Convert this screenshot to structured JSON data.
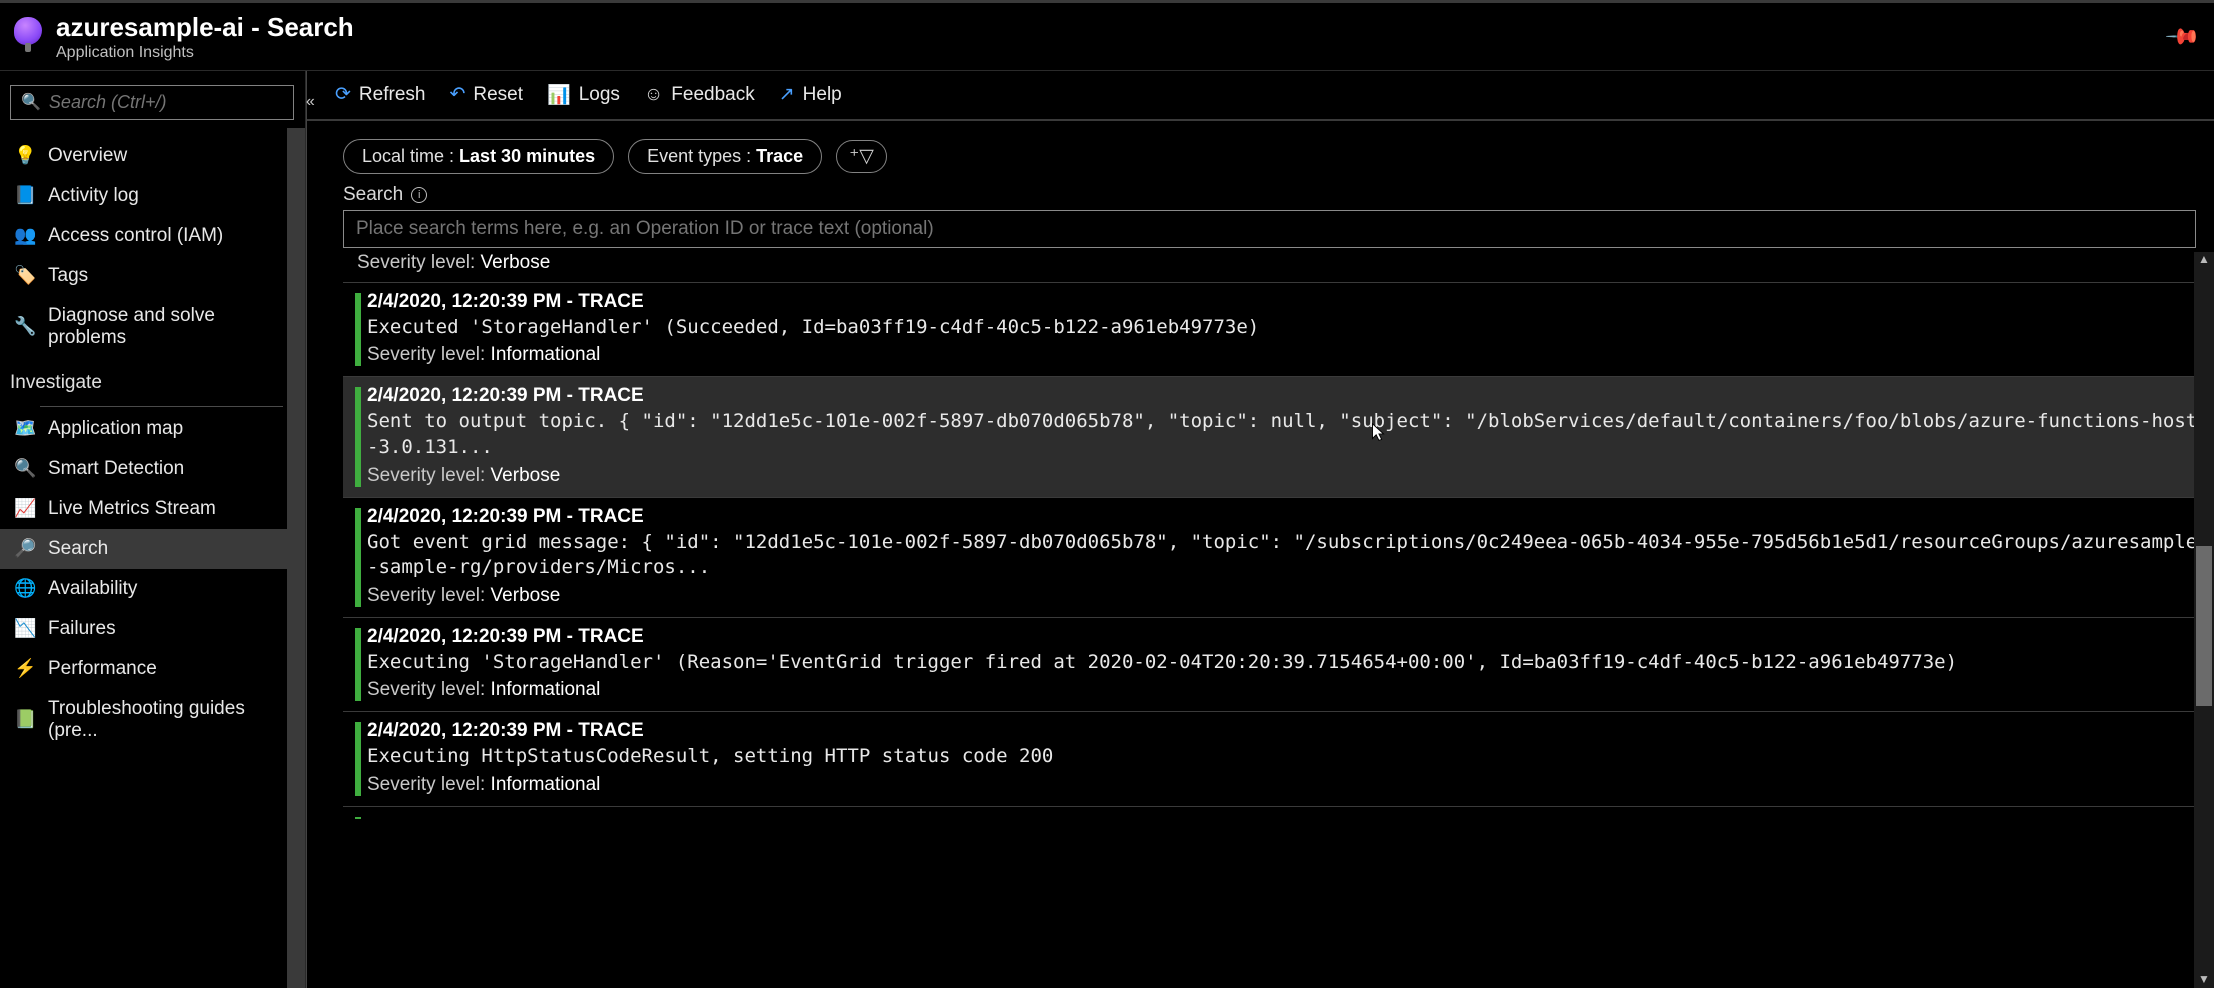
{
  "header": {
    "title": "azuresample-ai - Search",
    "subtitle": "Application Insights"
  },
  "sidebar": {
    "search_placeholder": "Search (Ctrl+/)",
    "items_top": [
      {
        "icon": "💡",
        "label": "Overview",
        "name": "sidebar-item-overview"
      },
      {
        "icon": "📘",
        "label": "Activity log",
        "name": "sidebar-item-activity-log"
      },
      {
        "icon": "👥",
        "label": "Access control (IAM)",
        "name": "sidebar-item-access-control"
      },
      {
        "icon": "🏷️",
        "label": "Tags",
        "name": "sidebar-item-tags"
      },
      {
        "icon": "🔧",
        "label": "Diagnose and solve problems",
        "name": "sidebar-item-diagnose"
      }
    ],
    "section_investigate": "Investigate",
    "items_investigate": [
      {
        "icon": "🗺️",
        "label": "Application map",
        "name": "sidebar-item-application-map"
      },
      {
        "icon": "🔍",
        "label": "Smart Detection",
        "name": "sidebar-item-smart-detection"
      },
      {
        "icon": "📈",
        "label": "Live Metrics Stream",
        "name": "sidebar-item-live-metrics"
      },
      {
        "icon": "🔎",
        "label": "Search",
        "name": "sidebar-item-search",
        "selected": true
      },
      {
        "icon": "🌐",
        "label": "Availability",
        "name": "sidebar-item-availability"
      },
      {
        "icon": "📉",
        "label": "Failures",
        "name": "sidebar-item-failures"
      },
      {
        "icon": "⚡",
        "label": "Performance",
        "name": "sidebar-item-performance"
      },
      {
        "icon": "📗",
        "label": "Troubleshooting guides (pre...",
        "name": "sidebar-item-troubleshooting"
      }
    ]
  },
  "toolbar": {
    "refresh": "Refresh",
    "reset": "Reset",
    "logs": "Logs",
    "feedback": "Feedback",
    "help": "Help"
  },
  "filters": {
    "time_prefix": "Local time : ",
    "time_value": "Last 30 minutes",
    "type_prefix": "Event types : ",
    "type_value": "Trace"
  },
  "search": {
    "label": "Search",
    "placeholder": "Place search terms here, e.g. an Operation ID or trace text (optional)"
  },
  "severity_label": "Severity level:",
  "top_sev_value": "Verbose",
  "traces": [
    {
      "head": "2/4/2020, 12:20:39 PM - TRACE",
      "msg": "Executed 'StorageHandler' (Succeeded, Id=ba03ff19-c4df-40c5-b122-a961eb49773e)",
      "sev": "Informational"
    },
    {
      "head": "2/4/2020, 12:20:39 PM - TRACE",
      "msg": "Sent to output topic. { \"id\": \"12dd1e5c-101e-002f-5897-db070d065b78\", \"topic\": null, \"subject\": \"/blobServices/default/containers/foo/blobs/azure-functions-host-3.0.131...",
      "sev": "Verbose",
      "hovered": true
    },
    {
      "head": "2/4/2020, 12:20:39 PM - TRACE",
      "msg": "Got event grid message: { \"id\": \"12dd1e5c-101e-002f-5897-db070d065b78\", \"topic\": \"/subscriptions/0c249eea-065b-4034-955e-795d56b1e5d1/resourceGroups/azuresample-sample-rg/providers/Micros...",
      "sev": "Verbose"
    },
    {
      "head": "2/4/2020, 12:20:39 PM - TRACE",
      "msg": "Executing 'StorageHandler' (Reason='EventGrid trigger fired at 2020-02-04T20:20:39.7154654+00:00', Id=ba03ff19-c4df-40c5-b122-a961eb49773e)",
      "sev": "Informational"
    },
    {
      "head": "2/4/2020, 12:20:39 PM - TRACE",
      "msg": "Executing HttpStatusCodeResult, setting HTTP status code 200",
      "sev": "Informational"
    }
  ]
}
